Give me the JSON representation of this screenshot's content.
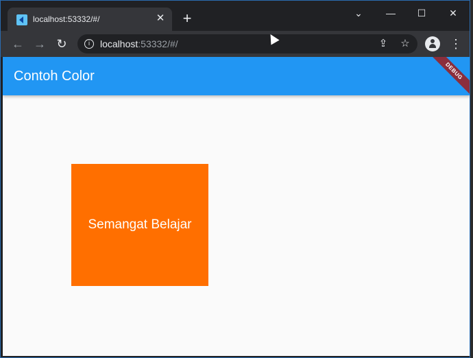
{
  "browser": {
    "tab_title": "localhost:53332/#/",
    "tab_close": "✕",
    "new_tab": "+",
    "url_host": "localhost",
    "url_rest": ":53332/#/",
    "window_controls": {
      "minimize": "—",
      "maximize": "☐",
      "close": "✕",
      "tab_search": "⌄"
    }
  },
  "app": {
    "appbar_title": "Contoh Color",
    "debug_banner": "DEBUG",
    "box_text": "Semangat Belajar",
    "colors": {
      "appbar": "#2196f3",
      "box": "#ff6f00",
      "background": "#fafafa"
    }
  }
}
